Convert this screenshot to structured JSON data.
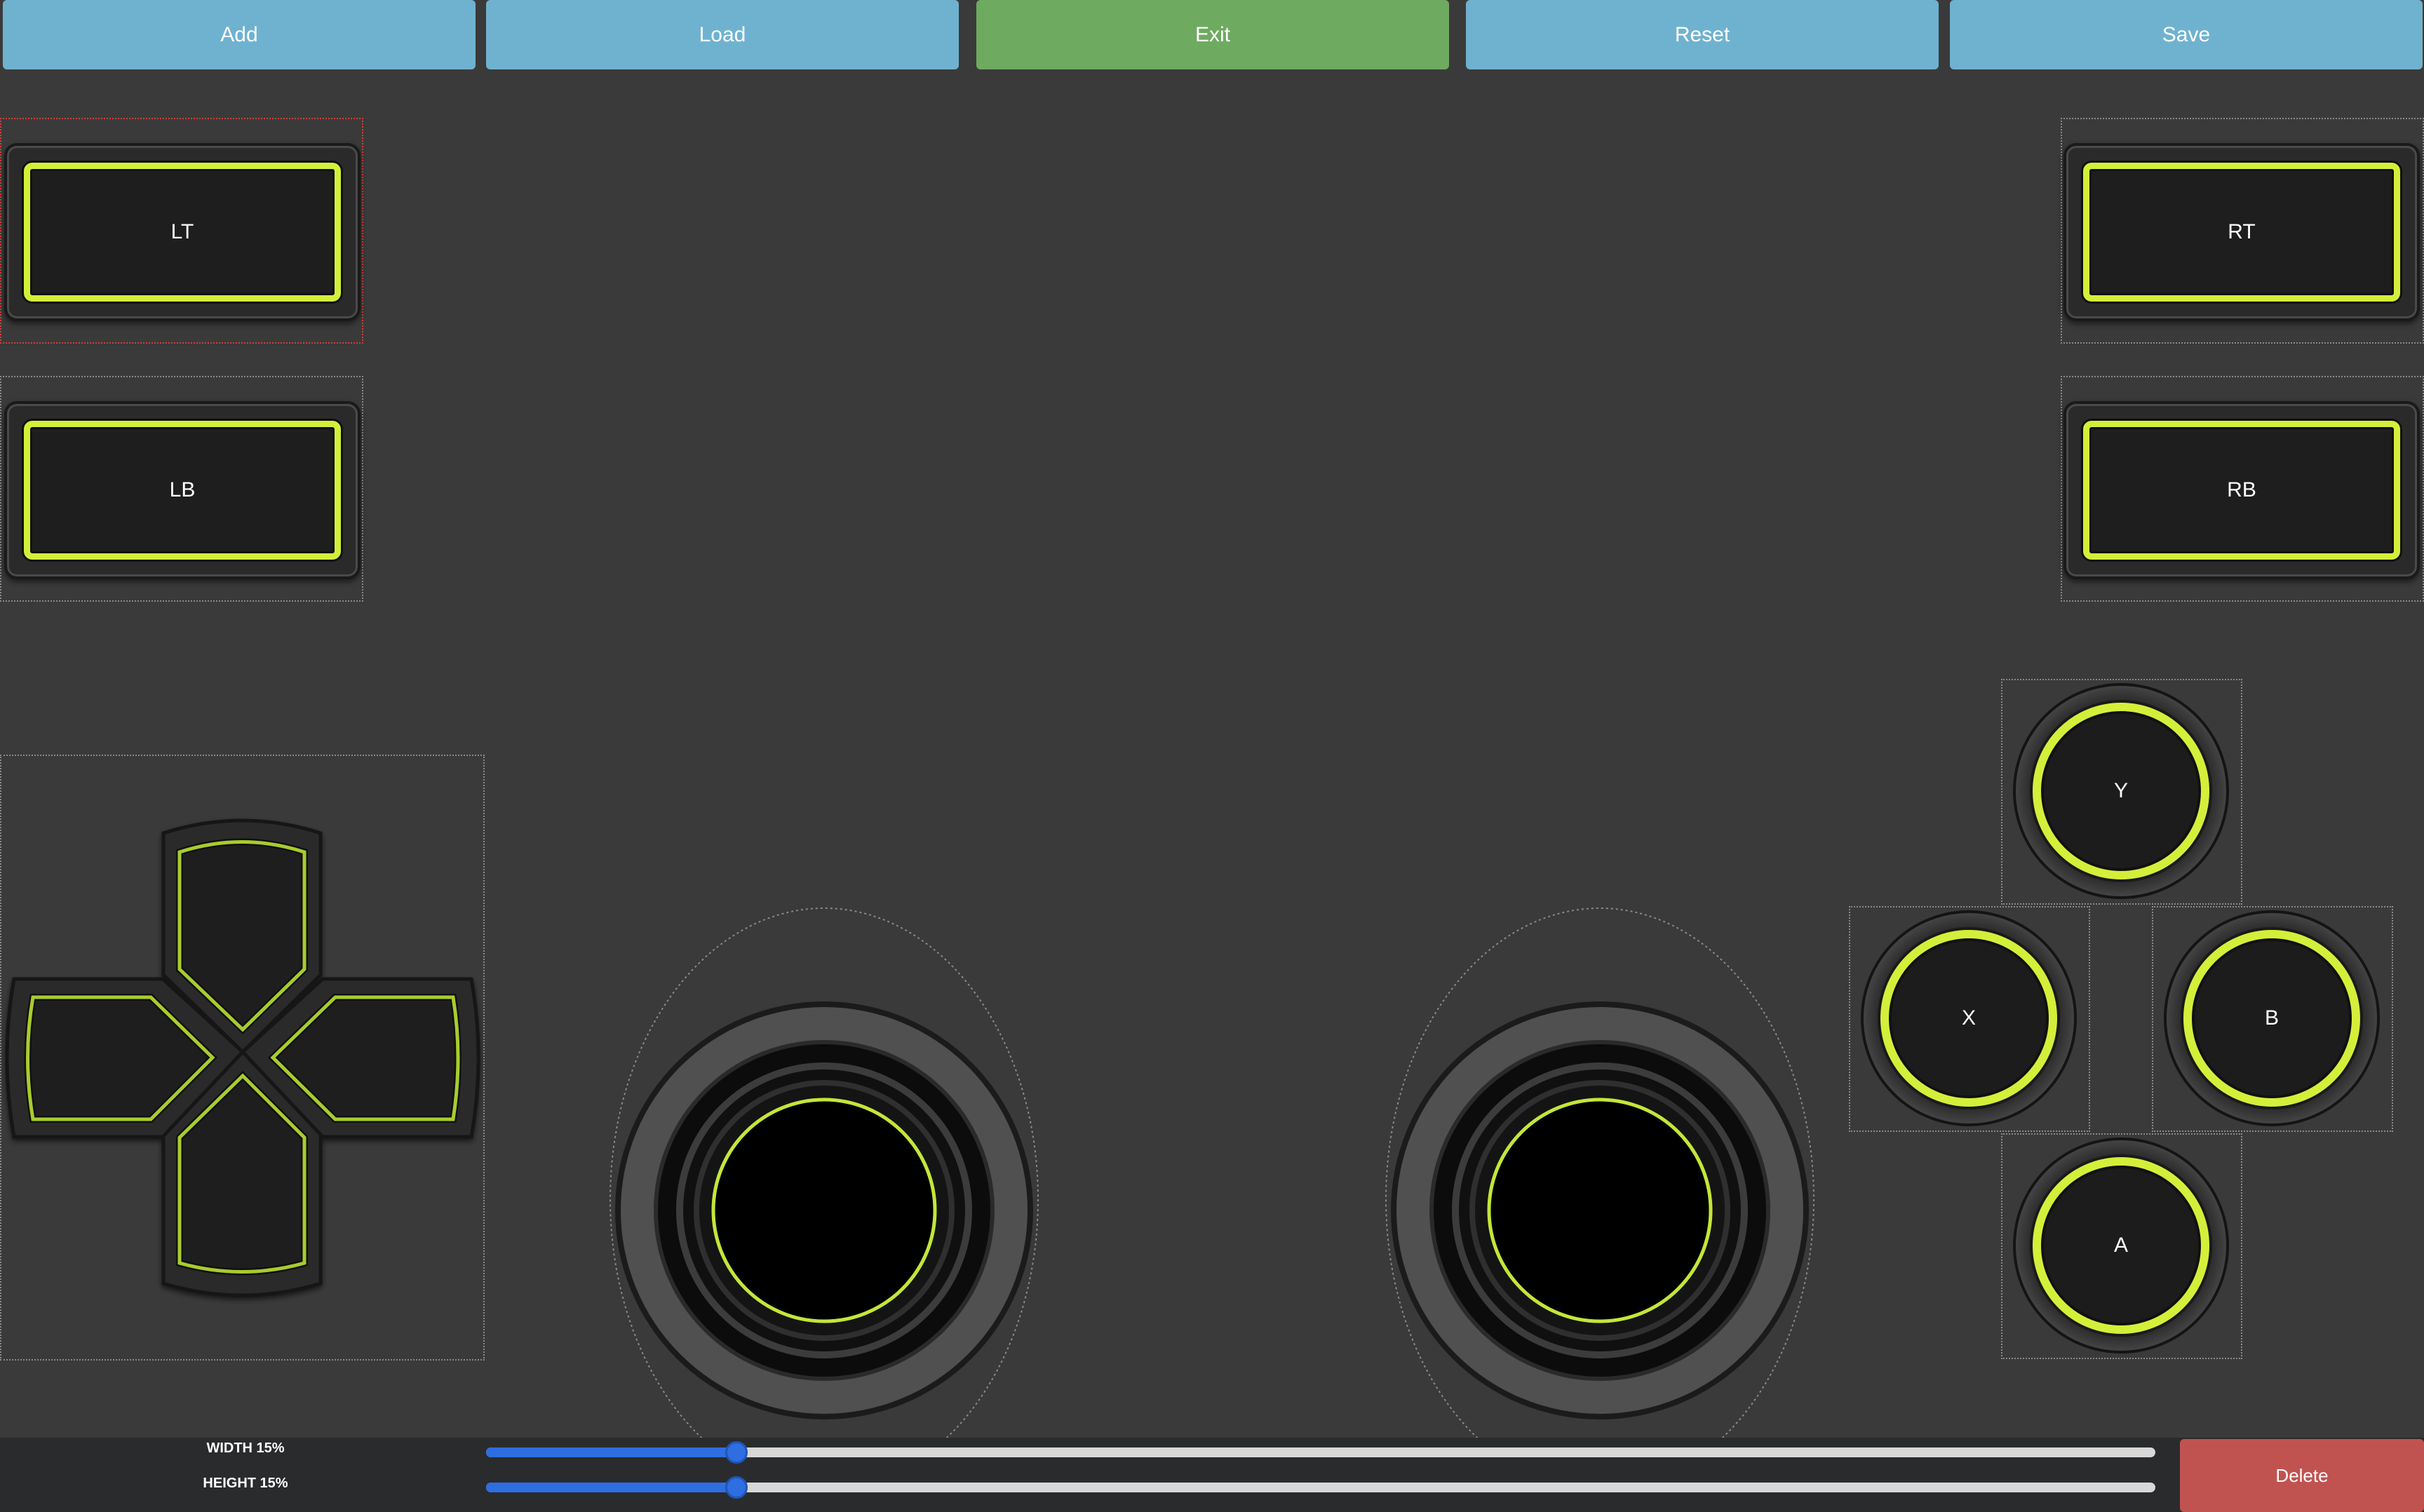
{
  "toolbar": {
    "add_label": "Add",
    "load_label": "Load",
    "exit_label": "Exit",
    "reset_label": "Reset",
    "save_label": "Save"
  },
  "controls": {
    "lt_label": "LT",
    "lb_label": "LB",
    "rt_label": "RT",
    "rb_label": "RB",
    "y_label": "Y",
    "x_label": "X",
    "b_label": "B",
    "a_label": "A"
  },
  "size_panel": {
    "width_label": "WIDTH 15%",
    "height_label": "HEIGHT 15%",
    "width_value": 15,
    "height_value": 15,
    "delete_label": "Delete"
  },
  "colors": {
    "background": "#3a3a3a",
    "accent": "#d4ef3a",
    "toolbar_blue": "#6fb2cf",
    "toolbar_green": "#6eaa60",
    "delete_red": "#c05350",
    "slider_blue": "#2e6ee0",
    "selection_red": "#d0403c"
  }
}
